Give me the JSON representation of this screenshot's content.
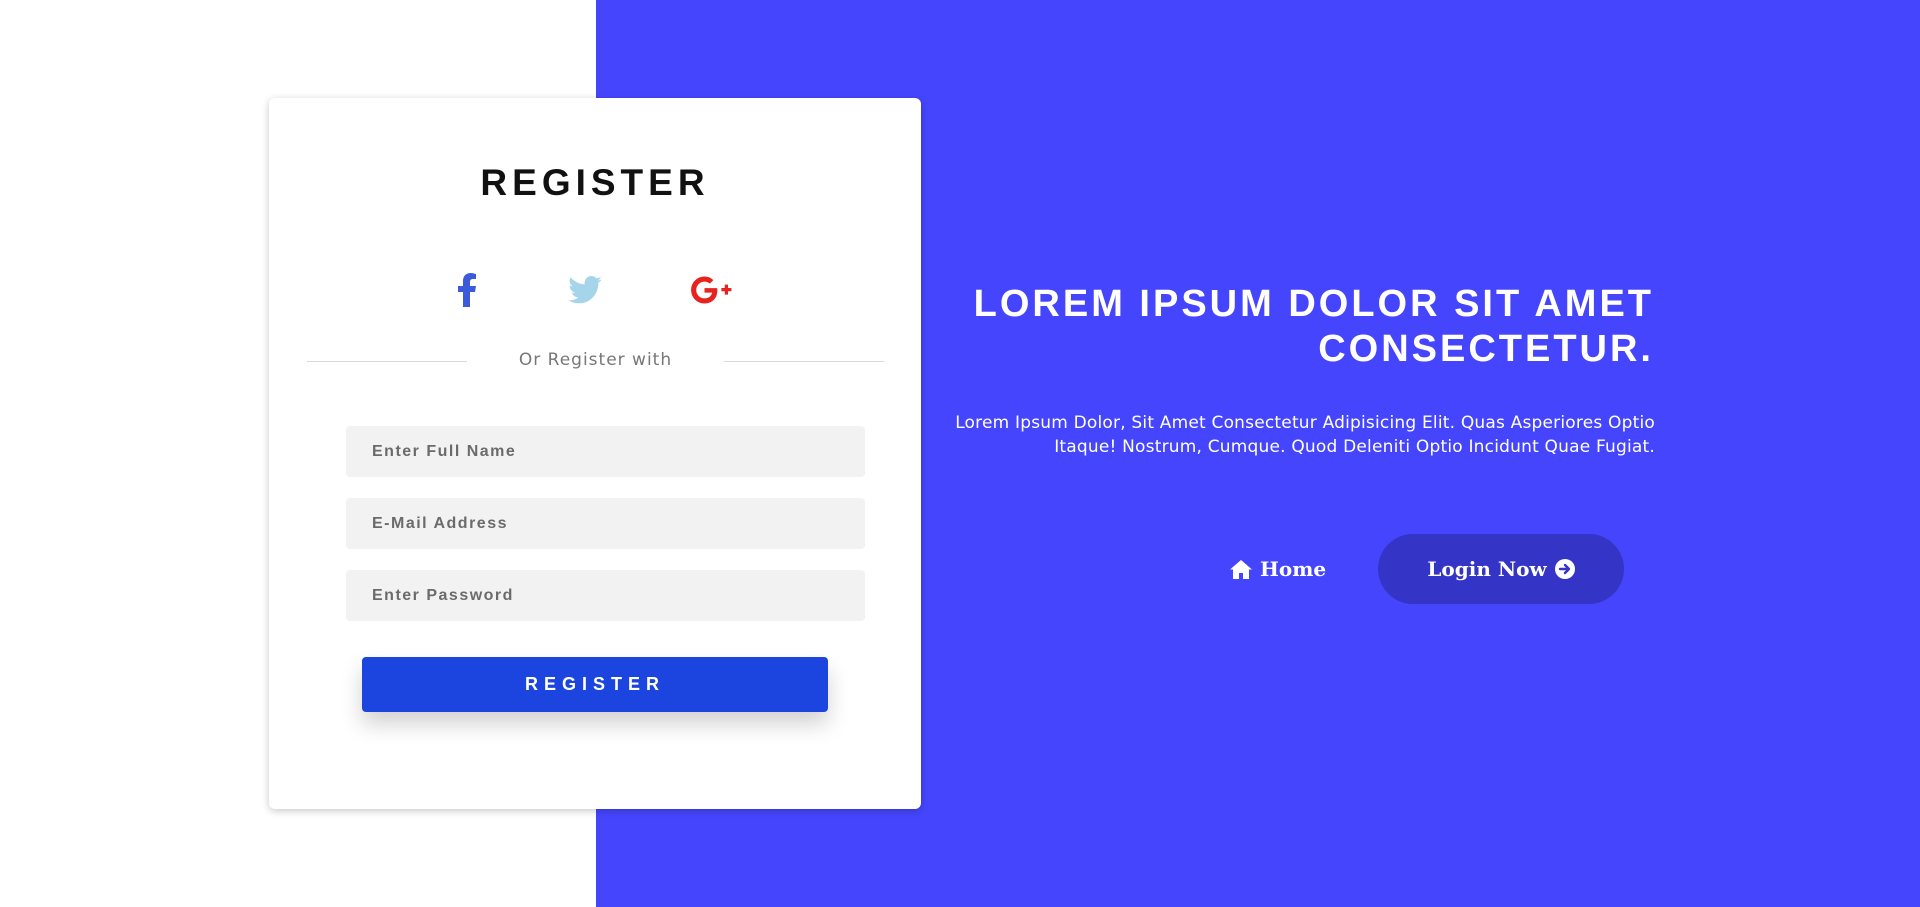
{
  "register_card": {
    "title": "REGISTER",
    "social": [
      {
        "name": "facebook",
        "icon": "facebook-icon",
        "color": "#3b5bdb"
      },
      {
        "name": "twitter",
        "icon": "twitter-icon",
        "color": "#a6d4ea"
      },
      {
        "name": "google-plus",
        "icon": "google-plus-icon",
        "color": "#e8231f"
      }
    ],
    "divider_text": "Or Register with",
    "fields": {
      "full_name": {
        "placeholder": "Enter Full Name",
        "value": ""
      },
      "email": {
        "placeholder": "E-Mail Address",
        "value": ""
      },
      "password": {
        "placeholder": "Enter Password",
        "value": ""
      }
    },
    "submit_label": "REGISTER"
  },
  "hero": {
    "title": "LOREM IPSUM DOLOR SIT AMET CONSECTETUR.",
    "text": "Lorem Ipsum Dolor, Sit Amet Consectetur Adipisicing Elit. Quas Asperiores Optio Itaque! Nostrum, Cumque. Quod Deleniti Optio Incidunt Quae Fugiat.",
    "home_label": "Home",
    "home_icon": "home-icon",
    "login_label": "Login Now",
    "login_icon": "arrow-circle-right-icon"
  },
  "colors": {
    "panel": "#4545fe",
    "register_button": "#1c44de",
    "login_button": "#3434c7",
    "input_bg": "#f2f2f2"
  }
}
